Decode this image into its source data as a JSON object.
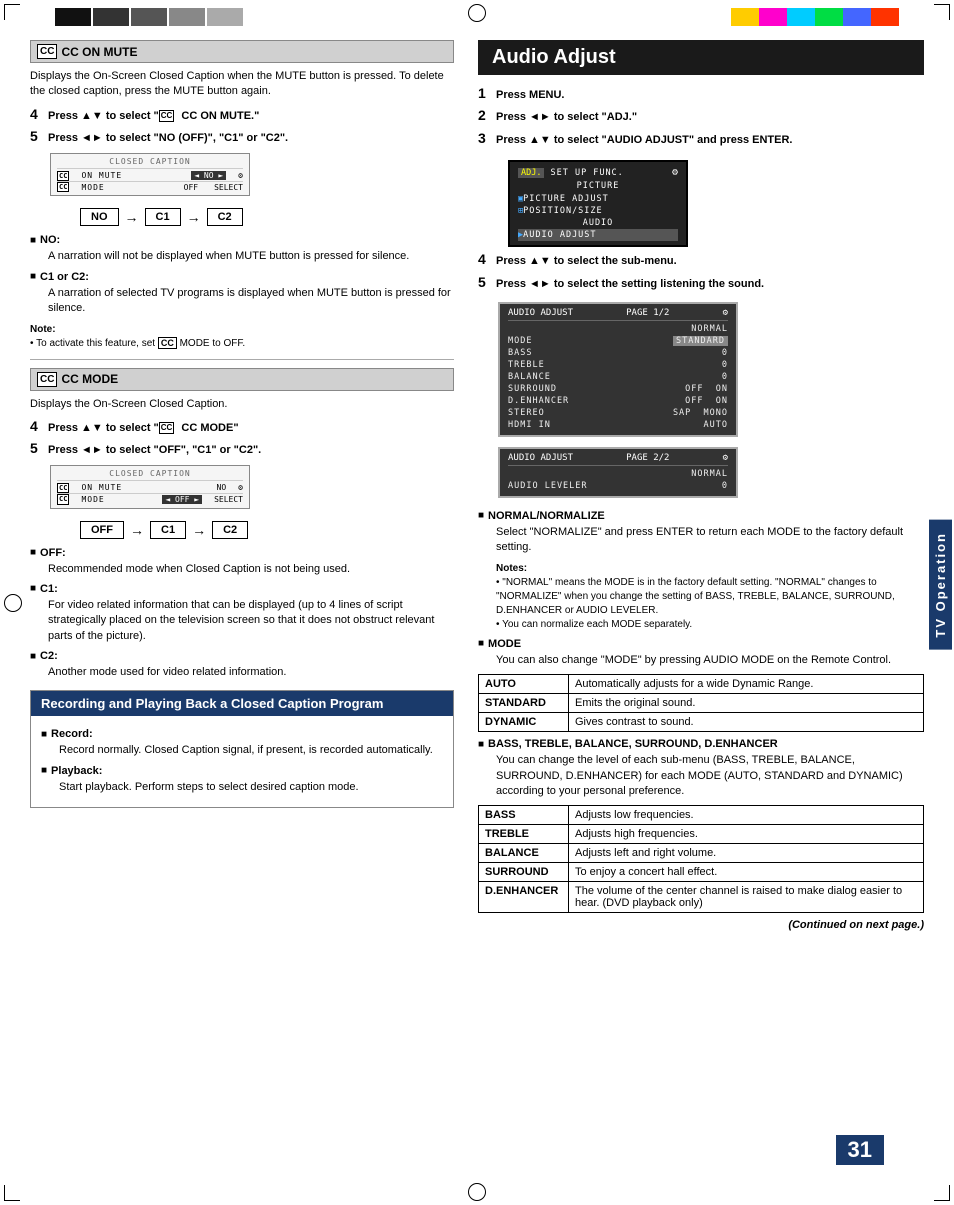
{
  "page": {
    "number": "31",
    "continued": "(Continued on next page.)"
  },
  "decorative": {
    "swatches_left": [
      "#111",
      "#333",
      "#555",
      "#888",
      "#aaa"
    ],
    "swatches_right": [
      "#ffcc00",
      "#ff00cc",
      "#00ccff",
      "#00ff66",
      "#0033cc",
      "#ff3300"
    ]
  },
  "left_col": {
    "cc_on_mute": {
      "header": "CC ON MUTE",
      "body": "Displays the On-Screen Closed Caption when the MUTE button is pressed. To delete the closed caption, press the MUTE button again.",
      "step4_num": "4",
      "step4_text": "Press ▲▼ to select \"",
      "step4_bold": "CC ON MUTE.",
      "step4_end": "\"",
      "step5_num": "5",
      "step5_text": "Press ◄► to select \"NO (OFF)\", \"C1\" or \"C2\".",
      "flow_no": "NO",
      "flow_c1": "C1",
      "flow_c2": "C2",
      "no_header": "NO:",
      "no_body": "A narration will not be displayed when MUTE button is pressed for silence.",
      "c1c2_header": "C1 or C2:",
      "c1c2_body": "A narration of selected TV programs is displayed when MUTE button is pressed for silence.",
      "note_label": "Note:",
      "note_body": "• To activate this feature, set  CC  MODE to OFF."
    },
    "cc_mode": {
      "header": "CC MODE",
      "body": "Displays the On-Screen Closed Caption.",
      "step4_num": "4",
      "step4_text": "Press ▲▼ to select \"",
      "step4_bold": "CC MODE",
      "step4_end": "\".",
      "step5_num": "5",
      "step5_text": "Press ◄► to select \"OFF\", \"C1\" or \"C2\".",
      "flow_off": "OFF",
      "flow_c1": "C1",
      "flow_c2": "C2",
      "off_header": "OFF:",
      "off_body": "Recommended mode when Closed Caption is not being used.",
      "c1_header": "C1:",
      "c1_body": "For video related information that can be displayed (up to 4 lines of script strategically placed on the television screen so that it does not obstruct relevant parts of the picture).",
      "c2_header": "C2:",
      "c2_body": "Another mode used for video related information."
    },
    "recording": {
      "header": "Recording and Playing Back a Closed Caption Program",
      "record_header": "Record:",
      "record_body": "Record normally. Closed Caption signal, if present, is recorded automatically.",
      "playback_header": "Playback:",
      "playback_body": "Start playback. Perform steps to select desired caption mode."
    }
  },
  "right_col": {
    "title": "Audio Adjust",
    "step1_num": "1",
    "step1_text": "Press MENU.",
    "step2_num": "2",
    "step2_text": "Press ◄► to select \"ADJ.\"",
    "step3_num": "3",
    "step3_text": "Press ▲▼ to select \"AUDIO ADJUST\" and press ENTER.",
    "menu_screen": {
      "row1": [
        "ADJ.",
        "SET UP",
        "FUNC."
      ],
      "row2": "PICTURE",
      "row3": "PICTURE ADJUST",
      "row4": "POSITION/SIZE",
      "row5": "AUDIO",
      "row6": "AUDIO ADJUST"
    },
    "step4_num": "4",
    "step4_text": "Press ▲▼ to select the sub-menu.",
    "step5_num": "5",
    "step5_text": "Press ◄► to select the setting listening the sound.",
    "audio_menu_page1": {
      "title": "AUDIO ADJUST",
      "page": "PAGE 1/2",
      "col_normal": "NORMAL",
      "rows": [
        {
          "key": "MODE",
          "val": "STANDARD"
        },
        {
          "key": "BASS",
          "val": "0"
        },
        {
          "key": "TREBLE",
          "val": "0"
        },
        {
          "key": "BALANCE",
          "val": "0"
        },
        {
          "key": "SURROUND",
          "val": "OFF ON"
        },
        {
          "key": "D.ENHANCER",
          "val": "OFF ON"
        },
        {
          "key": "STEREO",
          "val": "SAP MONO"
        },
        {
          "key": "HDMI IN",
          "val": "AUTO"
        }
      ]
    },
    "audio_menu_page2": {
      "title": "AUDIO ADJUST",
      "page": "PAGE 2/2",
      "col_normal": "NORMAL",
      "rows": [
        {
          "key": "AUDIO LEVELER",
          "val": "0"
        }
      ]
    },
    "normal_normalize": {
      "header": "NORMAL/NORMALIZE",
      "body": "Select \"NORMALIZE\" and press ENTER to return each MODE to the factory default setting.",
      "notes_label": "Notes:",
      "note1": "• \"NORMAL\" means the MODE is in the factory default setting. \"NORMAL\" changes to \"NORMALIZE\" when you change the setting of BASS, TREBLE, BALANCE, SURROUND, D.ENHANCER or AUDIO LEVELER.",
      "note2": "• You can normalize each MODE separately."
    },
    "mode_section": {
      "header": "MODE",
      "body": "You can also change \"MODE\" by pressing AUDIO MODE on the Remote Control.",
      "table": {
        "rows": [
          {
            "key": "AUTO",
            "val": "Automatically adjusts for a wide Dynamic Range."
          },
          {
            "key": "STANDARD",
            "val": "Emits the original sound."
          },
          {
            "key": "DYNAMIC",
            "val": "Gives contrast to sound."
          }
        ]
      }
    },
    "bass_section": {
      "header": "BASS, TREBLE, BALANCE, SURROUND, D.ENHANCER",
      "body": "You can change the level of each sub-menu (BASS, TREBLE, BALANCE, SURROUND, D.ENHANCER) for each MODE (AUTO, STANDARD and DYNAMIC) according to your personal preference.",
      "table": {
        "rows": [
          {
            "key": "BASS",
            "val": "Adjusts low frequencies."
          },
          {
            "key": "TREBLE",
            "val": "Adjusts high frequencies."
          },
          {
            "key": "BALANCE",
            "val": "Adjusts left and right volume."
          },
          {
            "key": "SURROUND",
            "val": "To enjoy a concert hall effect."
          },
          {
            "key": "D.ENHANCER",
            "val": "The volume of the center channel is raised to make dialog easier to hear. (DVD playback only)"
          }
        ]
      }
    }
  },
  "side_tab": "TV Operation"
}
